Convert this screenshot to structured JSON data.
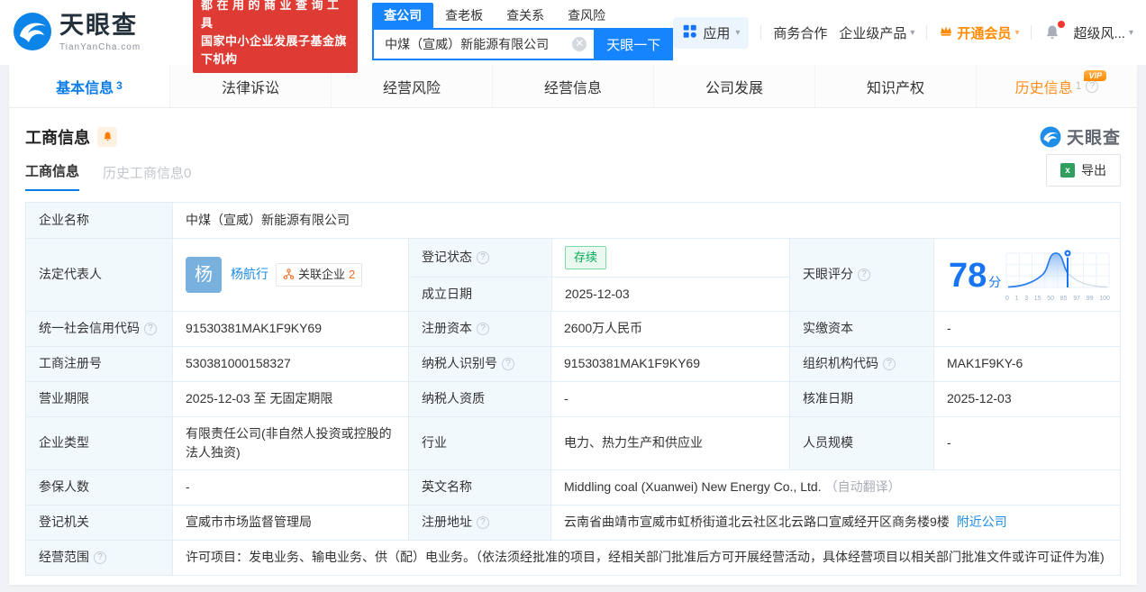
{
  "colors": {
    "brand_blue": "#1684fc",
    "active_tab_blue": "#0b7ce6",
    "link_blue": "#1d8ce8",
    "score_blue": "#1774f2",
    "vip_orange": "#ff8a00",
    "status_green": "#00a854",
    "slogan_red": "#dd3b33",
    "label_cell_bg": "#f2f9fd"
  },
  "header": {
    "brand": "天眼查",
    "brand_domain": "TianYanCha.com",
    "slogan_line1": "都在用的商业查询工具",
    "slogan_line2": "国家中小企业发展子基金旗下机构",
    "search_tabs": [
      {
        "label": "查公司"
      },
      {
        "label": "查老板"
      },
      {
        "label": "查关系"
      },
      {
        "label": "查风险"
      }
    ],
    "search_value": "中煤（宣威）新能源有限公司",
    "search_button": "天眼一下",
    "menu_apps": "应用",
    "menu_business": "商务合作",
    "menu_enterprise": "企业级产品",
    "menu_vip": "开通会员",
    "menu_super": "超级风..."
  },
  "nav": {
    "tab_basic": "基本信息",
    "tab_basic_count": "3",
    "tab_legal": "法律诉讼",
    "tab_risk": "经营风险",
    "tab_operation": "经营信息",
    "tab_development": "公司发展",
    "tab_ip": "知识产权",
    "tab_history": "历史信息",
    "tab_history_count": "1",
    "tab_history_vip": "VIP"
  },
  "section": {
    "title": "工商信息",
    "watermark": "天眼查",
    "tab_current": "工商信息",
    "tab_history": "历史工商信息0",
    "export_label": "导出"
  },
  "fields": {
    "company_name": {
      "label": "企业名称",
      "value": "中煤（宣威）新能源有限公司"
    },
    "legal_rep": {
      "label": "法定代表人",
      "avatar": "杨",
      "name": "杨航行",
      "related_label": "关联企业",
      "related_count": "2"
    },
    "reg_status": {
      "label": "登记状态",
      "value": "存续"
    },
    "est_date": {
      "label": "成立日期",
      "value": "2025-12-03"
    },
    "score": {
      "label": "天眼评分",
      "value": "78",
      "unit": "分"
    },
    "credit_code": {
      "label": "统一社会信用代码",
      "value": "91530381MAK1F9KY69"
    },
    "reg_capital": {
      "label": "注册资本",
      "value": "2600万人民币"
    },
    "paid_capital": {
      "label": "实缴资本",
      "value": "-"
    },
    "reg_no": {
      "label": "工商注册号",
      "value": "530381000158327"
    },
    "taxpayer_no": {
      "label": "纳税人识别号",
      "value": "91530381MAK1F9KY69"
    },
    "org_code": {
      "label": "组织机构代码",
      "value": "MAK1F9KY-6"
    },
    "term": {
      "label": "营业期限",
      "value": "2025-12-03 至 无固定期限"
    },
    "taxpayer_qual": {
      "label": "纳税人资质",
      "value": "-"
    },
    "approve_date": {
      "label": "核准日期",
      "value": "2025-12-03"
    },
    "company_type": {
      "label": "企业类型",
      "value": "有限责任公司(非自然人投资或控股的法人独资)"
    },
    "industry": {
      "label": "行业",
      "value": "电力、热力生产和供应业"
    },
    "staff_size": {
      "label": "人员规模",
      "value": "-"
    },
    "insured": {
      "label": "参保人数",
      "value": "-"
    },
    "english_name": {
      "label": "英文名称",
      "value": "Middling coal (Xuanwei) New Energy Co., Ltd.",
      "note": "（自动翻译）"
    },
    "authority": {
      "label": "登记机关",
      "value": "宣威市市场监督管理局"
    },
    "address": {
      "label": "注册地址",
      "value": "云南省曲靖市宣威市虹桥街道北云社区北云路口宣威经开区商务楼9楼",
      "link": "附近公司"
    },
    "scope": {
      "label": "经营范围",
      "value": "许可项目：发电业务、输电业务、供（配）电业务。（依法须经批准的项目，经相关部门批准后方可开展经营活动，具体经营项目以相关部门批准文件或许可证件为准)"
    }
  },
  "chart_data": {
    "type": "area",
    "title": "天眼评分分布曲线",
    "score": 78,
    "x_ticks": [
      "0",
      "1",
      "3",
      "15",
      "50",
      "85",
      "97",
      "99",
      "100"
    ],
    "legend_position": "none",
    "grid": true
  }
}
